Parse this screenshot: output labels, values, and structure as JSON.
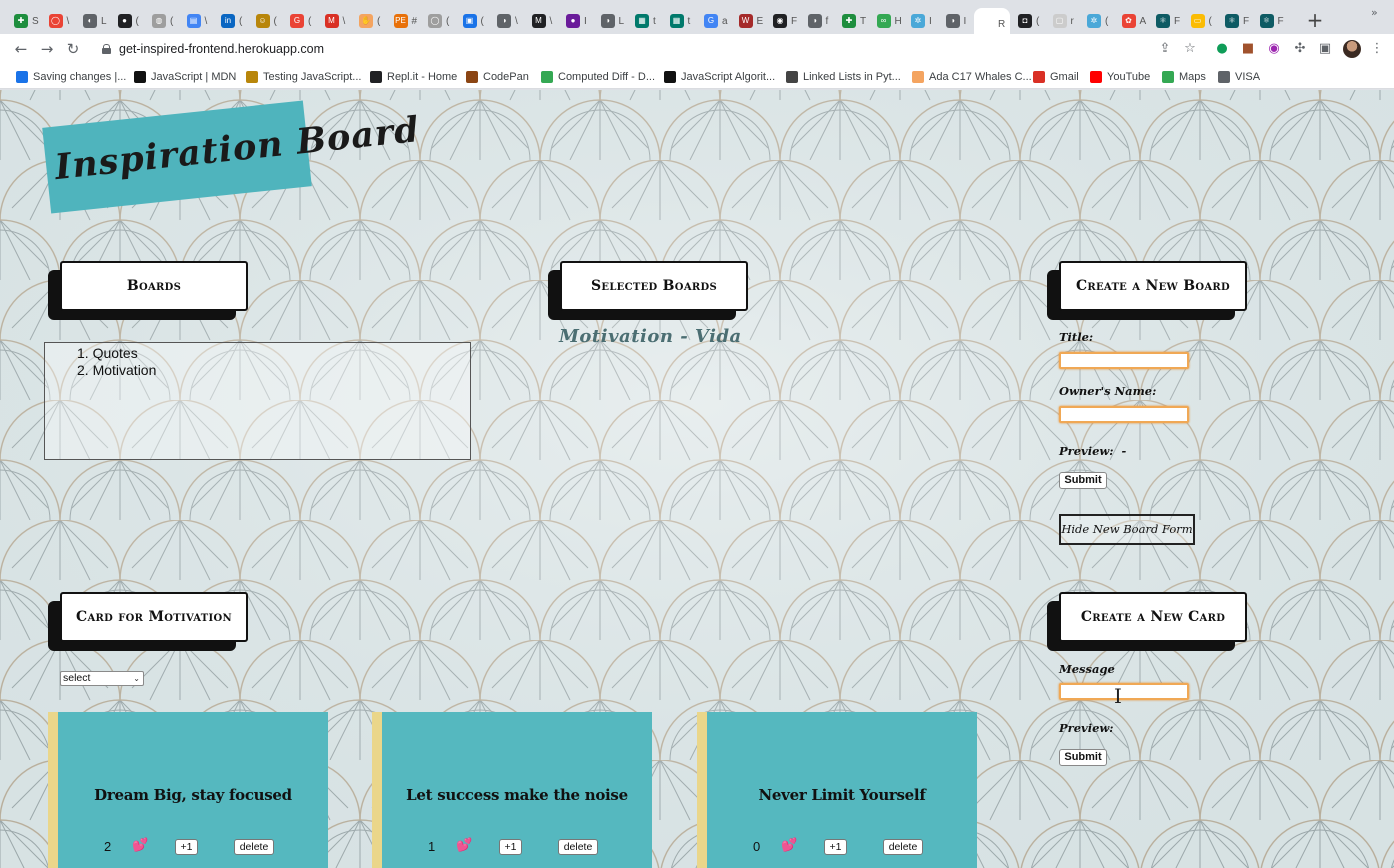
{
  "browser": {
    "url": "get-inspired-frontend.herokuapp.com",
    "tabs": [
      {
        "label": "S",
        "color": "#1e8e3e",
        "initial": "✚"
      },
      {
        "label": "\\",
        "color": "#ea4335",
        "initial": "◯"
      },
      {
        "label": "L",
        "color": "#5f6368",
        "initial": "◐"
      },
      {
        "label": "(",
        "color": "#202124",
        "initial": "●"
      },
      {
        "label": "(",
        "color": "#9e9e9e",
        "initial": "◍"
      },
      {
        "label": "\\",
        "color": "#4285f4",
        "initial": "▤"
      },
      {
        "label": "(",
        "color": "#0a66c2",
        "initial": "in"
      },
      {
        "label": "(",
        "color": "#b8860b",
        "initial": "☺"
      },
      {
        "label": "(",
        "color": "#ea4335",
        "initial": "G"
      },
      {
        "label": "\\",
        "color": "#d93025",
        "initial": "M"
      },
      {
        "label": "(",
        "color": "#f4a460",
        "initial": "✋"
      },
      {
        "label": "#",
        "color": "#e8710a",
        "initial": "PE"
      },
      {
        "label": "(",
        "color": "#9e9e9e",
        "initial": "◯"
      },
      {
        "label": "(",
        "color": "#1a73e8",
        "initial": "▣"
      },
      {
        "label": "\\",
        "color": "#5f6368",
        "initial": "◑"
      },
      {
        "label": "\\",
        "color": "#202124",
        "initial": "M"
      },
      {
        "label": "I",
        "color": "#6a1b9a",
        "initial": "●"
      },
      {
        "label": "L",
        "color": "#5f6368",
        "initial": "◑"
      },
      {
        "label": "t",
        "color": "#00796b",
        "initial": "▦"
      },
      {
        "label": "t",
        "color": "#00796b",
        "initial": "▦"
      },
      {
        "label": "a",
        "color": "#4285f4",
        "initial": "G"
      },
      {
        "label": "E",
        "color": "#a52a2a",
        "initial": "W"
      },
      {
        "label": "F",
        "color": "#202124",
        "initial": "◉"
      },
      {
        "label": "f",
        "color": "#5f6368",
        "initial": "◑"
      },
      {
        "label": "T",
        "color": "#1e8e3e",
        "initial": "✚"
      },
      {
        "label": "H",
        "color": "#34a853",
        "initial": "∞"
      },
      {
        "label": "I",
        "color": "#4aa8d8",
        "initial": "✲"
      },
      {
        "label": "I",
        "color": "#5f6368",
        "initial": "◑"
      },
      {
        "label": "R",
        "color": "#ffffff",
        "initial": "",
        "active": true
      },
      {
        "label": "(",
        "color": "#202124",
        "initial": "◘"
      },
      {
        "label": "r",
        "color": "#cccccc",
        "initial": "▢"
      },
      {
        "label": "(",
        "color": "#4aa8d8",
        "initial": "✲"
      },
      {
        "label": "A",
        "color": "#ea4335",
        "initial": "✿"
      },
      {
        "label": "F",
        "color": "#0e5b64",
        "initial": "⚛"
      },
      {
        "label": "(",
        "color": "#fbbc04",
        "initial": "▭"
      },
      {
        "label": "F",
        "color": "#0e5b64",
        "initial": "⚛"
      },
      {
        "label": "F",
        "color": "#0e5b64",
        "initial": "⚛"
      }
    ],
    "bookmarks": [
      {
        "label": "Saving changes |...",
        "color": "#1a73e8"
      },
      {
        "label": "JavaScript | MDN",
        "color": "#111111"
      },
      {
        "label": "Testing JavaScript...",
        "color": "#b8860b"
      },
      {
        "label": "Repl.it - Home",
        "color": "#202124"
      },
      {
        "label": "CodePan",
        "color": "#8b4513"
      },
      {
        "label": "Computed Diff - D...",
        "color": "#34a853"
      },
      {
        "label": "JavaScript Algorit...",
        "color": "#111111"
      },
      {
        "label": "Linked Lists in Pyt...",
        "color": "#444444"
      },
      {
        "label": "Ada C17 Whales C...",
        "color": "#f4a460"
      },
      {
        "label": "Gmail",
        "color": "#d93025"
      },
      {
        "label": "YouTube",
        "color": "#ff0000"
      },
      {
        "label": "Maps",
        "color": "#34a853"
      },
      {
        "label": "VISA",
        "color": "#5f6368"
      }
    ]
  },
  "app": {
    "logo": "Inspiration Board",
    "boards_header": "Boards",
    "boards": [
      "1. Quotes",
      "2. Motivation"
    ],
    "selected_header": "Selected Boards",
    "selected_board": "Motivation - Vida",
    "create_board_header": "Create a New Board",
    "title_label": "Title:",
    "owner_label": "Owner's Name:",
    "board_preview_label": "Preview:  -",
    "submit_label": "Submit",
    "hide_form_label": "Hide New Board Form",
    "cards_header": "Card for Motivation",
    "select_value": "select",
    "create_card_header": "Create a New Card",
    "message_label": "Message",
    "card_preview_label": "Preview:",
    "cards": [
      {
        "message": "Dream Big, stay focused",
        "likes": "2",
        "plus_label": "+1",
        "delete_label": "delete"
      },
      {
        "message": "Let success make the noise",
        "likes": "1",
        "plus_label": "+1",
        "delete_label": "delete"
      },
      {
        "message": "Never Limit Yourself",
        "likes": "0",
        "plus_label": "+1",
        "delete_label": "delete"
      }
    ],
    "colors": {
      "accent": "#4fb4bd",
      "card": "#55b8bf",
      "card_edge": "#ead68a",
      "input_focus": "#f0a855",
      "selected_text": "#4b6e72"
    }
  }
}
